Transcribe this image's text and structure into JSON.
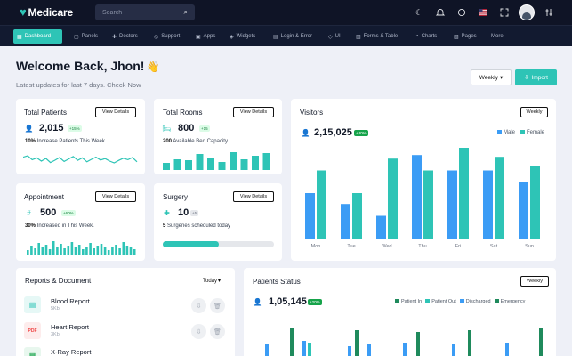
{
  "app": {
    "logo": "Medicare"
  },
  "search": {
    "placeholder": "Search"
  },
  "topbar_icons": [
    "moon-icon",
    "bell-icon",
    "chat-icon",
    "flag-icon",
    "fullscreen-icon"
  ],
  "nav": [
    {
      "label": "Dashboard",
      "icon": "grid-icon",
      "active": true
    },
    {
      "label": "Panels",
      "icon": "panel-icon"
    },
    {
      "label": "Doctors",
      "icon": "doctor-icon"
    },
    {
      "label": "Support",
      "icon": "support-icon"
    },
    {
      "label": "Apps",
      "icon": "apps-icon"
    },
    {
      "label": "Widgets",
      "icon": "widget-icon"
    },
    {
      "label": "Login & Error",
      "icon": "lock-icon"
    },
    {
      "label": "UI",
      "icon": "ui-icon"
    },
    {
      "label": "Forms & Table",
      "icon": "table-icon"
    },
    {
      "label": "Charts",
      "icon": "chart-icon"
    },
    {
      "label": "Pages",
      "icon": "pages-icon"
    },
    {
      "label": "More",
      "icon": "more-icon"
    }
  ],
  "header": {
    "welcome": "Welcome Back, Jhon!",
    "subtitle": "Latest updates for last 7 days. Check Now",
    "weekly_label": "Weekly",
    "import_label": "Import"
  },
  "cards": {
    "patients": {
      "title": "Total Patients",
      "value": "2,015",
      "badge": "+15%",
      "note_bold": "10%",
      "note": " Increase Patients This Week.",
      "button": "View Details",
      "sparkline": [
        62,
        70,
        48,
        58,
        40,
        55,
        32,
        45,
        60,
        38,
        52,
        66,
        44,
        58,
        36,
        50,
        62,
        46,
        54,
        40,
        30,
        44,
        56,
        48,
        60,
        36
      ]
    },
    "rooms": {
      "title": "Total Rooms",
      "value": "800",
      "badge": "+15",
      "note_bold": "200",
      "note": " Available Bed Capacity.",
      "button": "View Details",
      "bars": [
        40,
        60,
        55,
        90,
        65,
        45,
        100,
        60,
        80,
        95
      ]
    },
    "appointment": {
      "title": "Appointment",
      "value": "500",
      "badge": "+60%",
      "note_bold": "30%",
      "note": " Increased in This Week.",
      "button": "View Details",
      "bars": [
        30,
        55,
        40,
        70,
        45,
        60,
        35,
        80,
        50,
        65,
        40,
        55,
        75,
        45,
        60,
        35,
        50,
        70,
        40,
        55,
        65,
        45,
        30,
        50,
        60,
        40,
        75,
        55,
        45,
        35
      ]
    },
    "surgery": {
      "title": "Surgery",
      "value": "10",
      "badge": "+5",
      "note_bold": "5",
      "note": " Surgeries scheduled today",
      "button": "View Details",
      "progress": 0.5
    }
  },
  "visitors": {
    "title": "Visitors",
    "value": "2,15,025",
    "badge": "+30%",
    "button": "Weekly",
    "chart_data": {
      "type": "bar",
      "categories": [
        "Mon",
        "Tue",
        "Wed",
        "Thu",
        "Fri",
        "Sat",
        "Sun"
      ],
      "series": [
        {
          "name": "Male",
          "color": "#3b9cf5",
          "values": [
            50,
            38,
            25,
            92,
            75,
            75,
            62
          ]
        },
        {
          "name": "Female",
          "color": "#2ec4b6",
          "values": [
            75,
            50,
            88,
            75,
            100,
            90,
            80
          ]
        }
      ],
      "ylim": [
        0,
        100
      ]
    }
  },
  "documents": {
    "title": "Reports & Document",
    "filter": "Today",
    "items": [
      {
        "name": "Blood Report",
        "size": "5Kb",
        "color": "#2ec4b6",
        "bg": "#e6f8f6",
        "icon": "doc-icon"
      },
      {
        "name": "Heart Report",
        "size": "3Kb",
        "color": "#ef4444",
        "bg": "#fdecec",
        "icon": "pdf-icon"
      },
      {
        "name": "X-Ray Report",
        "size": "",
        "color": "#16a34a",
        "bg": "#e8f7ee",
        "icon": "xls-icon"
      }
    ]
  },
  "patients_status": {
    "title": "Patients Status",
    "value": "1,05,145",
    "badge": "+20%",
    "button": "Weekly",
    "chart_data": {
      "type": "bar",
      "series": [
        {
          "name": "Patient In",
          "color": "#1f8a5c"
        },
        {
          "name": "Patient Out",
          "color": "#2ec4b6"
        },
        {
          "name": "Discharged",
          "color": "#3b9cf5"
        },
        {
          "name": "Emergency",
          "color": "#1f8a5c"
        }
      ]
    }
  }
}
